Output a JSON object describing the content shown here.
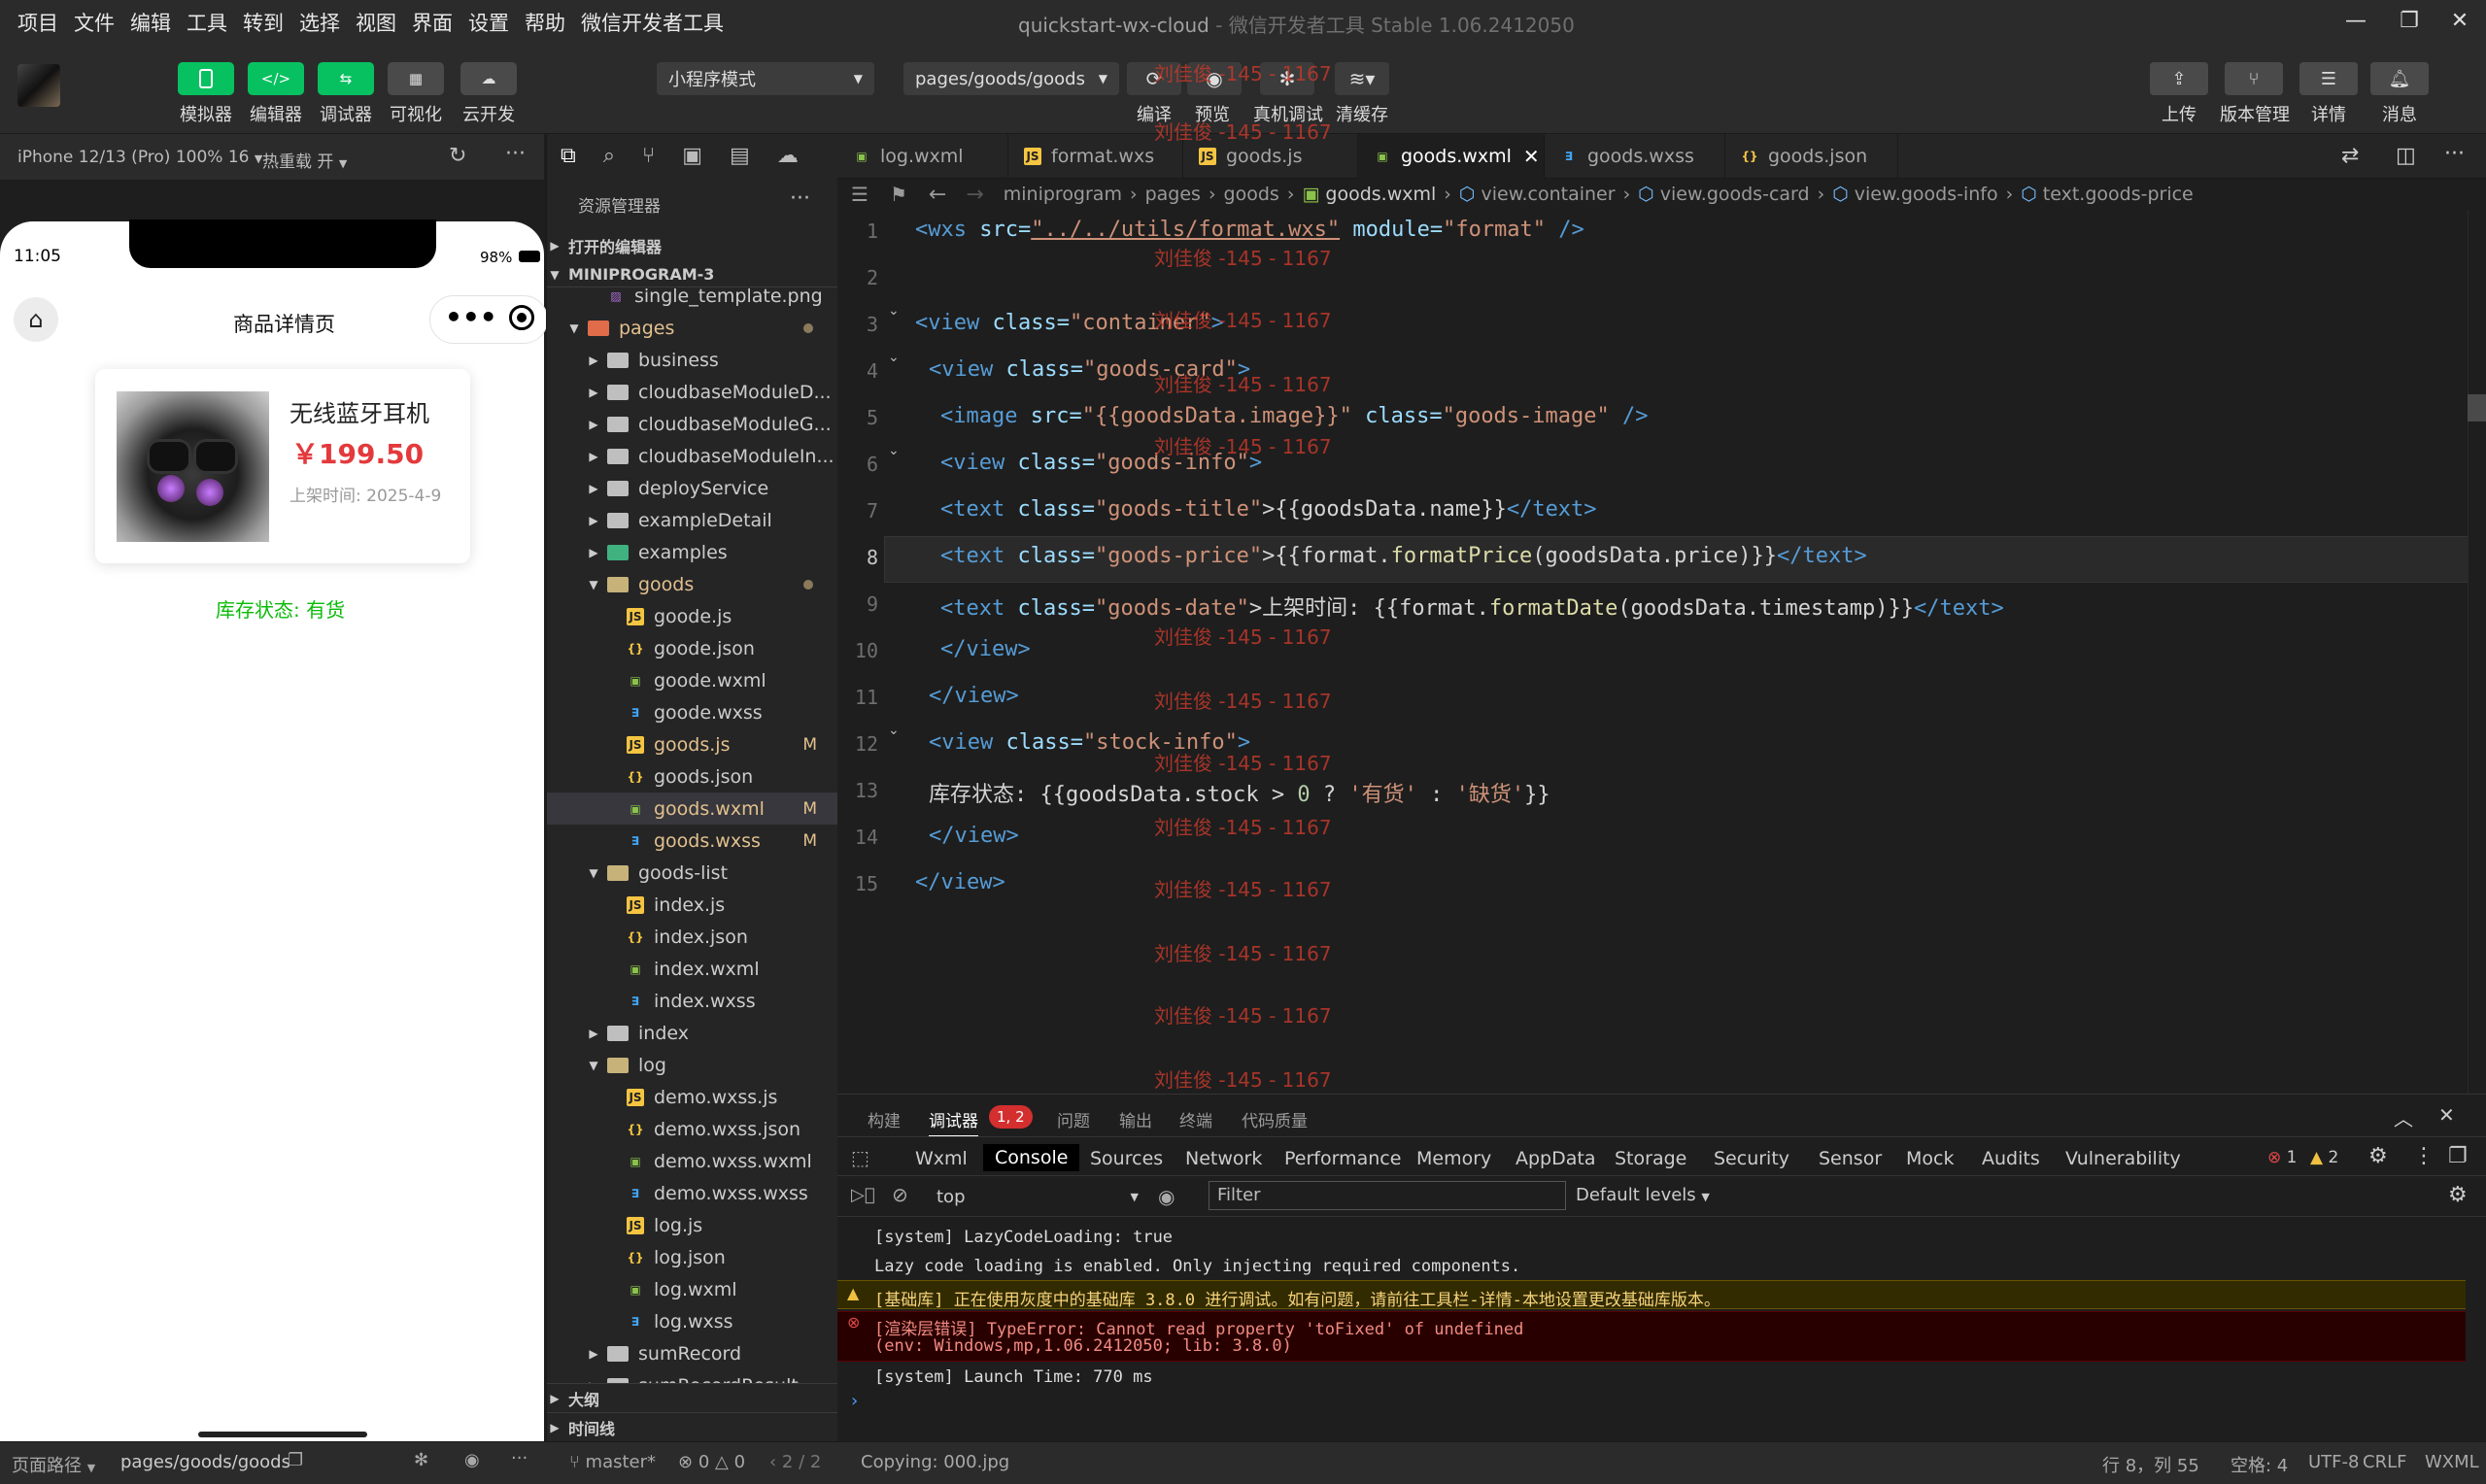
{
  "menu": [
    "项目",
    "文件",
    "编辑",
    "工具",
    "转到",
    "选择",
    "视图",
    "界面",
    "设置",
    "帮助",
    "微信开发者工具"
  ],
  "window_title": "quickstart-wx-cloud",
  "window_subtitle": "- 微信开发者工具 Stable 1.06.2412050",
  "toolbar": {
    "simulator": "模拟器",
    "editor": "编辑器",
    "debugger": "调试器",
    "visual": "可视化",
    "cloud": "云开发",
    "mode": "小程序模式",
    "path": "pages/goods/goods",
    "compile": "编译",
    "preview": "预览",
    "realdebug": "真机调试",
    "clearcache": "清缓存",
    "upload": "上传",
    "version": "版本管理",
    "details": "详情",
    "messages": "消息"
  },
  "simulator": {
    "device": "iPhone 12/13 (Pro) 100% 16",
    "hotreload": "热重载 开",
    "time": "11:05",
    "battery": "98%",
    "nav_title": "商品详情页",
    "product_name": "无线蓝牙耳机",
    "price": "￥199.50",
    "date": "上架时间: 2025-4-9",
    "stock": "库存状态: 有货"
  },
  "explorer": {
    "title": "资源管理器",
    "open_editors": "打开的编辑器",
    "project": "MINIPROGRAM-3",
    "outline": "大纲",
    "timeline": "时间线",
    "items": [
      {
        "label": "single_template.png",
        "kind": "img",
        "indent": 2
      },
      {
        "label": "pages",
        "kind": "folder-open",
        "indent": 1,
        "dot": true
      },
      {
        "label": "business",
        "kind": "folder",
        "indent": 2
      },
      {
        "label": "cloudbaseModuleD...",
        "kind": "folder",
        "indent": 2
      },
      {
        "label": "cloudbaseModuleG...",
        "kind": "folder",
        "indent": 2
      },
      {
        "label": "cloudbaseModuleIn...",
        "kind": "folder",
        "indent": 2
      },
      {
        "label": "deployService",
        "kind": "folder",
        "indent": 2
      },
      {
        "label": "exampleDetail",
        "kind": "folder",
        "indent": 2
      },
      {
        "label": "examples",
        "kind": "folder-g",
        "indent": 2
      },
      {
        "label": "goods",
        "kind": "folder-o",
        "indent": 2,
        "dot": true
      },
      {
        "label": "goode.js",
        "kind": "js",
        "indent": 3
      },
      {
        "label": "goode.json",
        "kind": "json",
        "indent": 3
      },
      {
        "label": "goode.wxml",
        "kind": "wxml",
        "indent": 3
      },
      {
        "label": "goode.wxss",
        "kind": "wxss",
        "indent": 3
      },
      {
        "label": "goods.js",
        "kind": "js",
        "indent": 3,
        "m": "M"
      },
      {
        "label": "goods.json",
        "kind": "json",
        "indent": 3
      },
      {
        "label": "goods.wxml",
        "kind": "wxml",
        "indent": 3,
        "m": "M",
        "sel": true
      },
      {
        "label": "goods.wxss",
        "kind": "wxss",
        "indent": 3,
        "m": "M"
      },
      {
        "label": "goods-list",
        "kind": "folder-o",
        "indent": 2
      },
      {
        "label": "index.js",
        "kind": "js",
        "indent": 3
      },
      {
        "label": "index.json",
        "kind": "json",
        "indent": 3
      },
      {
        "label": "index.wxml",
        "kind": "wxml",
        "indent": 3
      },
      {
        "label": "index.wxss",
        "kind": "wxss",
        "indent": 3
      },
      {
        "label": "index",
        "kind": "folder",
        "indent": 2
      },
      {
        "label": "log",
        "kind": "folder-o",
        "indent": 2
      },
      {
        "label": "demo.wxss.js",
        "kind": "js",
        "indent": 3
      },
      {
        "label": "demo.wxss.json",
        "kind": "json",
        "indent": 3
      },
      {
        "label": "demo.wxss.wxml",
        "kind": "wxml",
        "indent": 3
      },
      {
        "label": "demo.wxss.wxss",
        "kind": "wxss",
        "indent": 3
      },
      {
        "label": "log.js",
        "kind": "js",
        "indent": 3
      },
      {
        "label": "log.json",
        "kind": "json",
        "indent": 3
      },
      {
        "label": "log.wxml",
        "kind": "wxml",
        "indent": 3
      },
      {
        "label": "log.wxss",
        "kind": "wxss",
        "indent": 3
      },
      {
        "label": "sumRecord",
        "kind": "folder",
        "indent": 2
      },
      {
        "label": "sumRecordResult",
        "kind": "folder",
        "indent": 2
      }
    ]
  },
  "tabs": [
    {
      "label": "log.wxml",
      "kind": "wxml"
    },
    {
      "label": "format.wxs",
      "kind": "js"
    },
    {
      "label": "goods.js",
      "kind": "js"
    },
    {
      "label": "goods.wxml",
      "kind": "wxml",
      "active": true
    },
    {
      "label": "goods.wxss",
      "kind": "wxss"
    },
    {
      "label": "goods.json",
      "kind": "json"
    }
  ],
  "breadcrumb": [
    "miniprogram",
    "pages",
    "goods",
    "goods.wxml",
    "view.container",
    "view.goods-card",
    "view.goods-info",
    "text.goods-price"
  ],
  "code": {
    "l1": [
      "<wxs ",
      "src=",
      "\"../../utils/format.wxs\"",
      " module=",
      "\"format\"",
      " />"
    ],
    "l3": [
      "<view ",
      "class=",
      "\"container\"",
      ">"
    ],
    "l4": [
      "<view ",
      "class=",
      "\"goods-card\"",
      ">"
    ],
    "l5": [
      "<image ",
      "src=",
      "\"{{goodsData.image}}\"",
      " class=",
      "\"goods-image\"",
      " />"
    ],
    "l6": [
      "<view ",
      "class=",
      "\"goods-info\"",
      ">"
    ],
    "l7": [
      "<text ",
      "class=",
      "\"goods-title\"",
      ">{{goodsData.name}}",
      "</text>"
    ],
    "l8": [
      "<text ",
      "class=",
      "\"goods-price\"",
      ">{{format.",
      "formatPrice",
      "(goodsData.price)}}",
      "</text>"
    ],
    "l9": [
      "<text ",
      "class=",
      "\"goods-date\"",
      ">上架时间: {{format.",
      "formatDate",
      "(goodsData.timestamp)}}",
      "</text>"
    ],
    "l10": "</view>",
    "l11": "</view>",
    "l12": [
      "<view ",
      "class=",
      "\"stock-info\"",
      ">"
    ],
    "l13": [
      "库存状态: {{goodsData.stock ",
      "> ",
      "0",
      " ? ",
      "'有货'",
      " : ",
      "'缺货'",
      "}}"
    ],
    "l14": "</view>",
    "l15": "</view>"
  },
  "watermark": "刘佳俊 -145 - 1167",
  "panel": {
    "tabs": [
      "构建",
      "调试器",
      "问题",
      "输出",
      "终端",
      "代码质量"
    ],
    "badge": "1, 2",
    "devtabs": [
      "Wxml",
      "Console",
      "Sources",
      "Network",
      "Performance",
      "Memory",
      "AppData",
      "Storage",
      "Security",
      "Sensor",
      "Mock",
      "Audits",
      "Vulnerability"
    ],
    "errcount": "1",
    "warncount": "2",
    "context": "top",
    "filter": "Filter",
    "levels": "Default levels",
    "logs": [
      "[system] LazyCodeLoading: true",
      "Lazy code loading is enabled. Only injecting required components.",
      "[基础库] 正在使用灰度中的基础库 3.8.0 进行调试。如有问题，请前往工具栏-详情-本地设置更改基础库版本。",
      "[渲染层错误] TypeError: Cannot read property 'toFixed' of undefined",
      "(env: Windows,mp,1.06.2412050; lib: 3.8.0)",
      "[system] Launch Time: 770 ms"
    ]
  },
  "status": {
    "pagepath_label": "页面路径",
    "pagepath": "pages/goods/goods",
    "branch": "master*",
    "errs": "0",
    "warns": "0",
    "pages": "2 / 2",
    "copying": "Copying: 000.jpg",
    "pos": "行 8，列 55",
    "spaces": "空格: 4",
    "enc": "UTF-8",
    "eol": "CRLF",
    "lang": "WXML"
  }
}
